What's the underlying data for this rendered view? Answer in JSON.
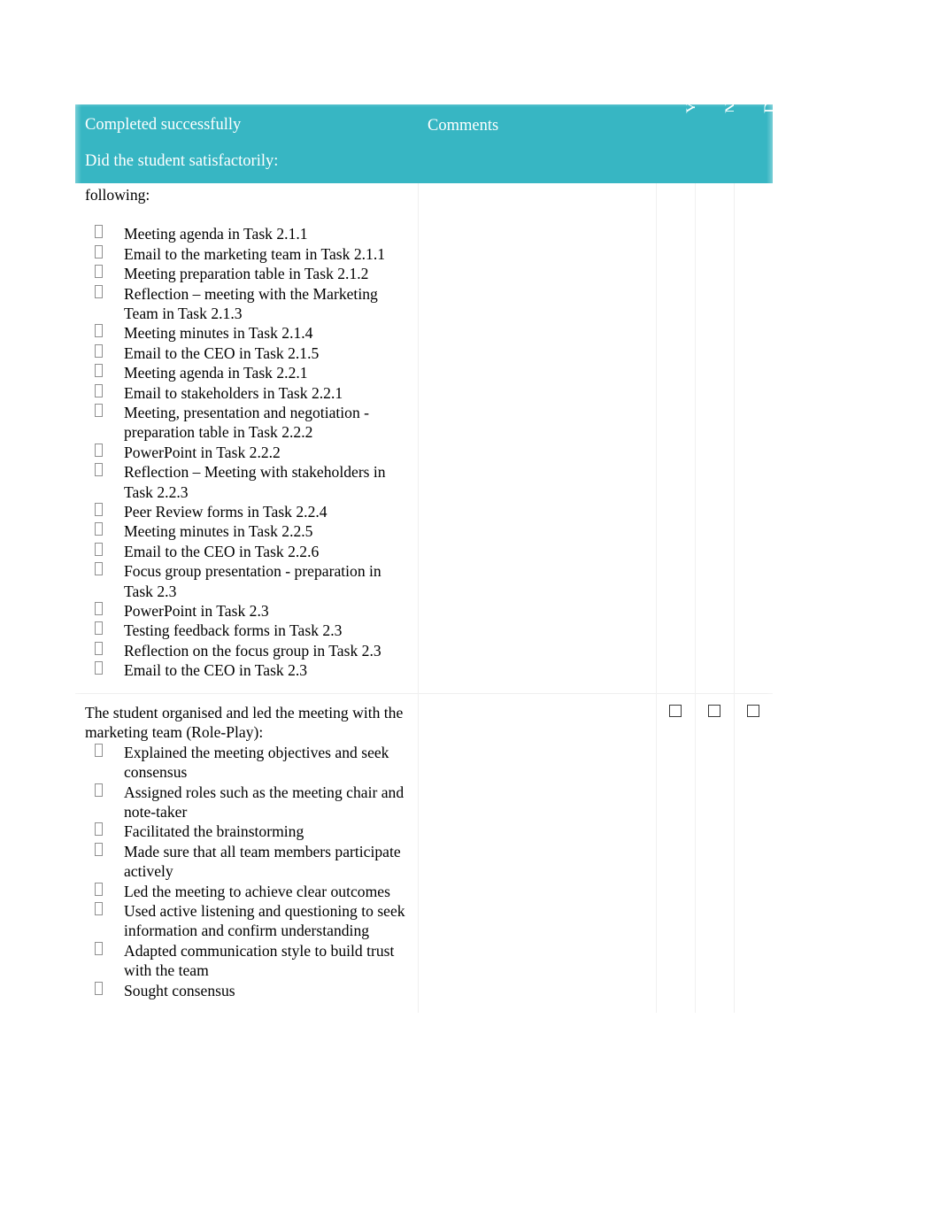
{
  "theme": {
    "header_bg": "#37b6c3",
    "header_text": "#ffffff",
    "body_text": "#000000",
    "grid_line": "#f0f0f0",
    "checkbox_border": "#3b3b3b"
  },
  "table": {
    "header": {
      "criteria_line1": "Completed successfully",
      "criteria_line2": "Did the student satisfactorily:",
      "comments": "Comments",
      "col_y": "Y",
      "col_n": "N",
      "col_dns": "DNS"
    },
    "rows": [
      {
        "lead_text": "following:",
        "items": [
          "Meeting agenda in Task 2.1.1",
          "Email to the marketing team in Task 2.1.1",
          "Meeting preparation table in Task 2.1.2",
          "Reflection – meeting with the Marketing Team in Task 2.1.3",
          "Meeting minutes in Task 2.1.4",
          "Email to the CEO in Task 2.1.5",
          "Meeting agenda in Task 2.2.1",
          "Email to stakeholders in Task 2.2.1",
          "Meeting, presentation and negotiation - preparation table in Task 2.2.2",
          "PowerPoint in Task 2.2.2",
          "Reflection – Meeting with stakeholders in Task 2.2.3",
          "Peer Review forms in Task 2.2.4",
          "Meeting minutes in Task 2.2.5",
          "Email to the CEO in Task 2.2.6",
          "Focus group presentation - preparation in Task 2.3",
          "PowerPoint in Task 2.3",
          "Testing feedback forms in Task 2.3",
          "Reflection on the focus group in Task 2.3",
          "Email to the CEO in Task 2.3"
        ],
        "comments": "",
        "y_checked": false,
        "n_checked": false,
        "dns_checked": false,
        "show_checkboxes": false
      },
      {
        "lead_text": "The student organised and led the meeting with the marketing team (Role-Play):",
        "items": [
          "Explained the meeting objectives and seek consensus",
          "Assigned roles such as the meeting chair and note-taker",
          "Facilitated the brainstorming",
          "Made sure that all team members participate actively",
          "Led the meeting to achieve clear outcomes",
          "Used active listening and questioning to seek information and confirm understanding",
          "Adapted communication style to build trust with the team",
          "Sought consensus"
        ],
        "comments": "",
        "y_checked": false,
        "n_checked": false,
        "dns_checked": false,
        "show_checkboxes": true
      }
    ]
  }
}
